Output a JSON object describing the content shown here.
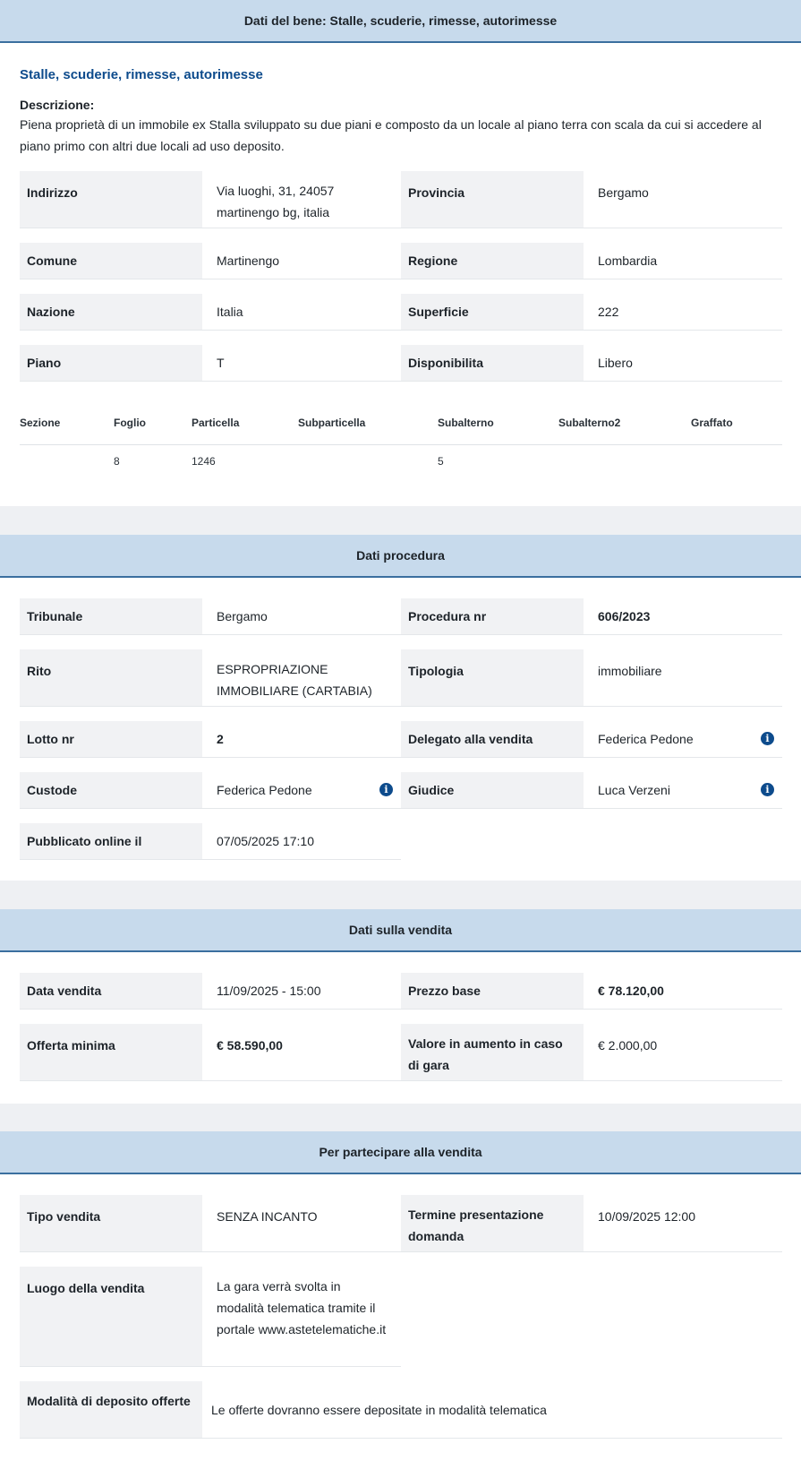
{
  "bene": {
    "header": "Dati del bene: Stalle, scuderie, rimesse, autorimesse",
    "subtitle": "Stalle, scuderie, rimesse, autorimesse",
    "desc_label": "Descrizione:",
    "desc_text": "Piena proprietà di un immobile ex Stalla sviluppato su due piani e composto da un locale al piano terra con scala da cui si accedere al piano primo con altri due locali ad uso deposito.",
    "fields": {
      "indirizzo_label": "Indirizzo",
      "indirizzo_value": "Via luoghi, 31, 24057 martinengo bg, italia",
      "provincia_label": "Provincia",
      "provincia_value": "Bergamo",
      "comune_label": "Comune",
      "comune_value": "Martinengo",
      "regione_label": "Regione",
      "regione_value": "Lombardia",
      "nazione_label": "Nazione",
      "nazione_value": "Italia",
      "superficie_label": "Superficie",
      "superficie_value": "222",
      "piano_label": "Piano",
      "piano_value": "T",
      "disponibilita_label": "Disponibilita",
      "disponibilita_value": "Libero"
    },
    "catasto": {
      "headers": [
        "Sezione",
        "Foglio",
        "Particella",
        "Subparticella",
        "Subalterno",
        "Subalterno2",
        "Graffato"
      ],
      "row": [
        "",
        "8",
        "1246",
        "",
        "5",
        "",
        ""
      ]
    }
  },
  "procedura": {
    "header": "Dati procedura",
    "tribunale_label": "Tribunale",
    "tribunale_value": "Bergamo",
    "procedura_label": "Procedura nr",
    "procedura_value": "606/2023",
    "rito_label": "Rito",
    "rito_value": "ESPROPRIAZIONE IMMOBILIARE (CARTABIA)",
    "tipologia_label": "Tipologia",
    "tipologia_value": "immobiliare",
    "lotto_label": "Lotto nr",
    "lotto_value": "2",
    "delegato_label": "Delegato alla vendita",
    "delegato_value": "Federica Pedone",
    "custode_label": "Custode",
    "custode_value": "Federica Pedone",
    "giudice_label": "Giudice",
    "giudice_value": "Luca Verzeni",
    "pubblicato_label": "Pubblicato online il",
    "pubblicato_value": "07/05/2025 17:10",
    "info_glyph": "i"
  },
  "vendita": {
    "header": "Dati sulla vendita",
    "data_label": "Data vendita",
    "data_value": "11/09/2025 - 15:00",
    "prezzo_label": "Prezzo base",
    "prezzo_value": "€ 78.120,00",
    "offerta_label": "Offerta minima",
    "offerta_value": "€ 58.590,00",
    "aumento_label": "Valore in aumento in caso di gara",
    "aumento_value": "€ 2.000,00"
  },
  "partecipare": {
    "header": "Per partecipare alla vendita",
    "tipo_label": "Tipo vendita",
    "tipo_value": "SENZA INCANTO",
    "termine_label": "Termine presentazione domanda",
    "termine_value": "10/09/2025 12:00",
    "luogo_label": "Luogo della vendita",
    "luogo_value": "La gara verrà svolta in modalità telematica tramite il portale www.astetelematiche.it",
    "modalita_label": "Modalità di deposito offerte",
    "modalita_value": "Le offerte dovranno essere depositate in modalità telematica"
  }
}
